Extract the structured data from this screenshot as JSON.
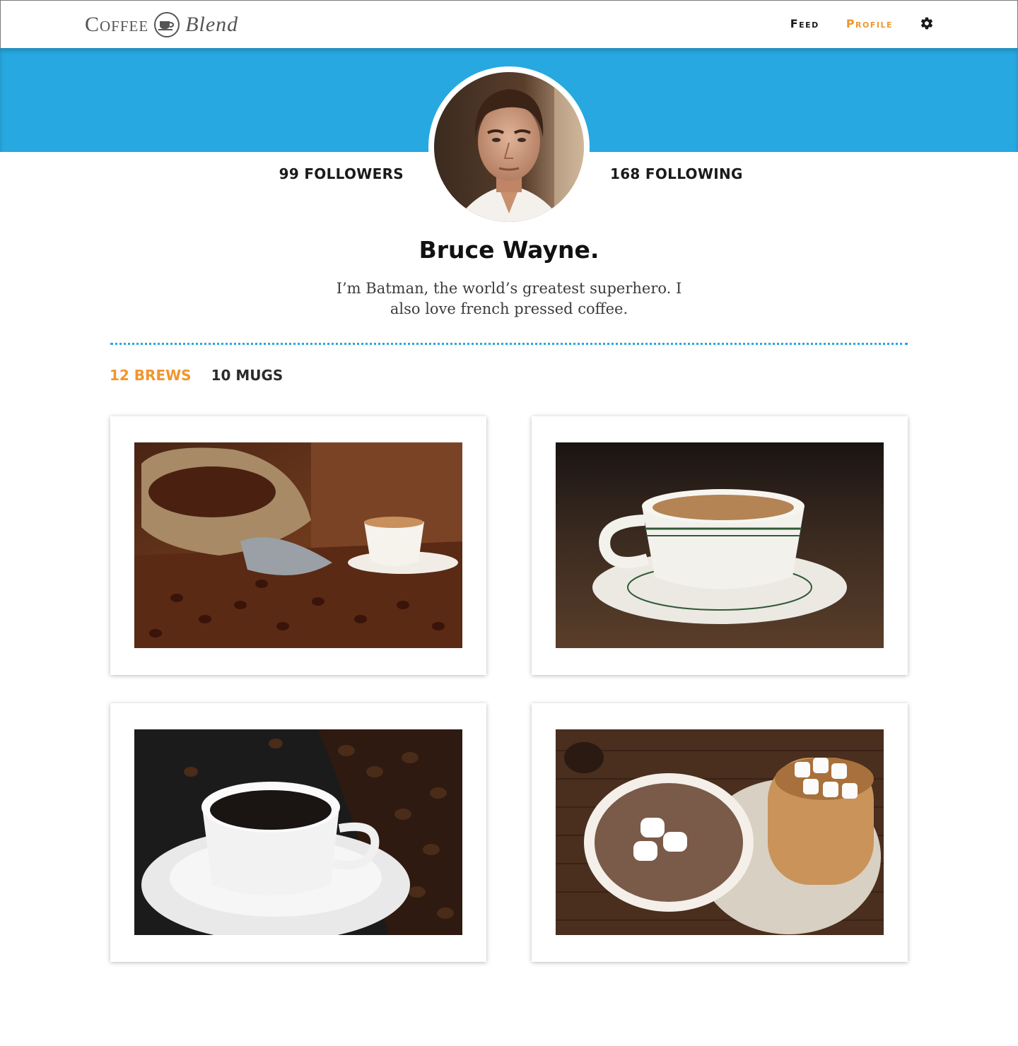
{
  "header": {
    "logo_word_1": "Coffee",
    "logo_word_2": "Blend",
    "nav": [
      {
        "label": "Feed",
        "active": false
      },
      {
        "label": "Profile",
        "active": true
      }
    ],
    "settings_icon": "gear-icon"
  },
  "colors": {
    "banner": "#27a8e0",
    "accent": "#f0962d"
  },
  "profile": {
    "followers": "99 Followers",
    "following": "168 Following",
    "name": "Bruce Wayne.",
    "bio": "I’m Batman, the world’s greatest superhero.  I also love french pressed coffee."
  },
  "tabs": [
    {
      "label": "12 Brews",
      "active": true
    },
    {
      "label": "10 Mugs",
      "active": false
    }
  ],
  "brews": [
    {
      "photo": "coffee-beans-sack-with-cup"
    },
    {
      "photo": "latte-in-striped-diner-cup"
    },
    {
      "photo": "black-coffee-with-beans"
    },
    {
      "photo": "hot-chocolate-with-marshmallows"
    }
  ]
}
